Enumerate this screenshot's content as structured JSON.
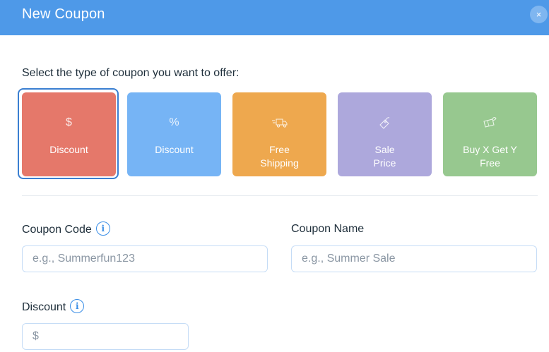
{
  "dialog": {
    "title": "New Coupon",
    "close_glyph": "×"
  },
  "prompt": "Select the type of coupon you want to offer:",
  "coupon_types": [
    {
      "icon": "dollar-icon",
      "glyph": "$",
      "label_line1": "Discount",
      "label_line2": "",
      "color": "#e5786a",
      "selected": true
    },
    {
      "icon": "percent-icon",
      "glyph": "%",
      "label_line1": "Discount",
      "label_line2": "",
      "color": "#76b4f5",
      "selected": false
    },
    {
      "icon": "truck-icon",
      "glyph": "",
      "label_line1": "Free",
      "label_line2": "Shipping",
      "color": "#eea84e",
      "selected": false
    },
    {
      "icon": "price-tag-icon",
      "glyph": "",
      "label_line1": "Sale",
      "label_line2": "Price",
      "color": "#ada8dc",
      "selected": false
    },
    {
      "icon": "gift-card-icon",
      "glyph": "",
      "label_line1": "Buy X Get Y",
      "label_line2": "Free",
      "color": "#97c88f",
      "selected": false
    }
  ],
  "fields": {
    "coupon_code": {
      "label": "Coupon Code",
      "placeholder": "e.g., Summerfun123",
      "value": ""
    },
    "coupon_name": {
      "label": "Coupon Name",
      "placeholder": "e.g., Summer Sale",
      "value": ""
    },
    "discount": {
      "label": "Discount",
      "placeholder": "$",
      "value": ""
    }
  },
  "info_glyph": "i",
  "colors": {
    "header": "#4e99e8",
    "accent": "#3a8ee6",
    "input_border": "#c5dcf6"
  }
}
